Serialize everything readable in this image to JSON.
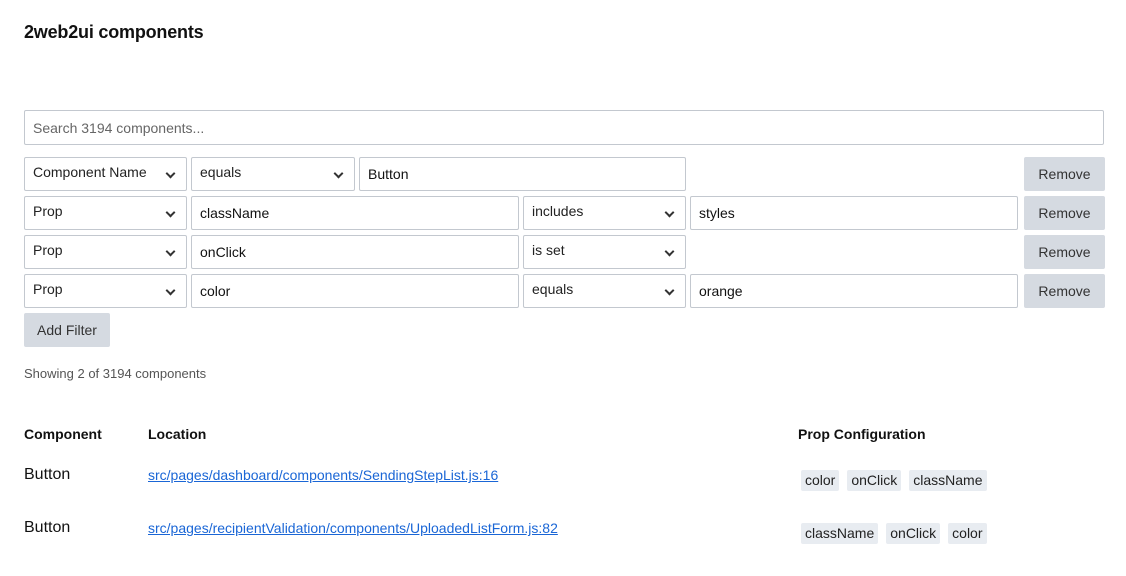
{
  "header": {
    "title": "2web2ui components"
  },
  "search": {
    "placeholder": "Search 3194 components..."
  },
  "filters": [
    {
      "type": "Component Name",
      "operator": "equals",
      "value": "Button",
      "remove_label": "Remove"
    },
    {
      "type": "Prop",
      "prop_name": "className",
      "operator": "includes",
      "value": "styles",
      "remove_label": "Remove"
    },
    {
      "type": "Prop",
      "prop_name": "onClick",
      "operator": "is set",
      "remove_label": "Remove"
    },
    {
      "type": "Prop",
      "prop_name": "color",
      "operator": "equals",
      "value": "orange",
      "remove_label": "Remove"
    }
  ],
  "add_filter_label": "Add Filter",
  "status": {
    "showing_text": "Showing 2 of 3194 components"
  },
  "results": {
    "columns": [
      "Component",
      "Location",
      "Prop Configuration"
    ],
    "rows": [
      {
        "component": "Button",
        "location": "src/pages/dashboard/components/SendingStepList.js:16",
        "props": [
          "color",
          "onClick",
          "className"
        ]
      },
      {
        "component": "Button",
        "location": "src/pages/recipientValidation/components/UploadedListForm.js:82",
        "props": [
          "className",
          "onClick",
          "color"
        ]
      }
    ]
  },
  "colors": {
    "link": "#1a66d6",
    "button_bg": "#d5dae1",
    "tag_bg": "#e8ecf1",
    "border": "#c3c8cf"
  }
}
